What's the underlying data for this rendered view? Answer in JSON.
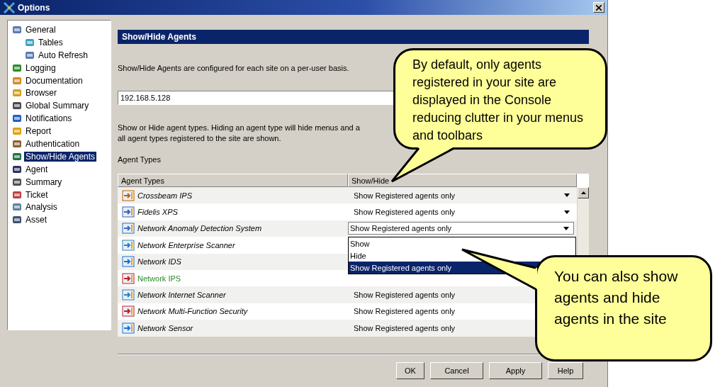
{
  "window": {
    "title": "Options"
  },
  "tree": [
    {
      "label": "General",
      "selected": false,
      "children": [
        {
          "label": "Tables",
          "selected": false
        },
        {
          "label": "Auto Refresh",
          "selected": false
        }
      ]
    },
    {
      "label": "Logging",
      "selected": false
    },
    {
      "label": "Documentation",
      "selected": false
    },
    {
      "label": "Browser",
      "selected": false
    },
    {
      "label": "Global Summary",
      "selected": false
    },
    {
      "label": "Notifications",
      "selected": false
    },
    {
      "label": "Report",
      "selected": false
    },
    {
      "label": "Authentication",
      "selected": false
    },
    {
      "label": "Show/Hide Agents",
      "selected": true
    },
    {
      "label": "Agent",
      "selected": false
    },
    {
      "label": "Summary",
      "selected": false
    },
    {
      "label": "Ticket",
      "selected": false
    },
    {
      "label": "Analysis",
      "selected": false
    },
    {
      "label": "Asset",
      "selected": false
    }
  ],
  "panel": {
    "title": "Show/Hide Agents",
    "intro": "Show/Hide Agents are configured for each site on a per-user basis.",
    "site": "192.168.5.128",
    "description": [
      "Show or Hide agent types. Hiding an agent type will hide menus and a",
      "all agent types registered to the site are shown."
    ],
    "group_title": "Agent Types",
    "columns": [
      "Agent Types",
      "Show/Hide"
    ],
    "rows": [
      {
        "name": "Crossbeam IPS",
        "registered": false,
        "value": "Show Registered agents only",
        "arrow": true
      },
      {
        "name": "Fidelis XPS",
        "registered": false,
        "value": "Show Registered agents only",
        "arrow": true
      },
      {
        "name": "Network Anomaly Detection System",
        "registered": false,
        "value": "Show Registered agents only",
        "arrow": true,
        "open": true
      },
      {
        "name": "Network Enterprise Scanner",
        "registered": false
      },
      {
        "name": "Network IDS",
        "registered": false
      },
      {
        "name": "Network IPS",
        "registered": true
      },
      {
        "name": "Network Internet Scanner",
        "registered": false,
        "value": "Show Registered agents only"
      },
      {
        "name": "Network Multi-Function Security",
        "registered": false,
        "value": "Show Registered agents only"
      },
      {
        "name": "Network Sensor",
        "registered": false,
        "value": "Show Registered agents only"
      }
    ],
    "dropdown_options": [
      {
        "label": "Show",
        "selected": false
      },
      {
        "label": "Hide",
        "selected": false
      },
      {
        "label": "Show Registered agents only",
        "selected": true
      }
    ]
  },
  "buttons": [
    "OK",
    "Cancel",
    "Apply",
    "Help"
  ],
  "callouts": [
    "By default, only agents registered in your site are displayed in the Console reducing clutter in your menus and toolbars",
    "You can also show agents and hide agents in the site"
  ]
}
